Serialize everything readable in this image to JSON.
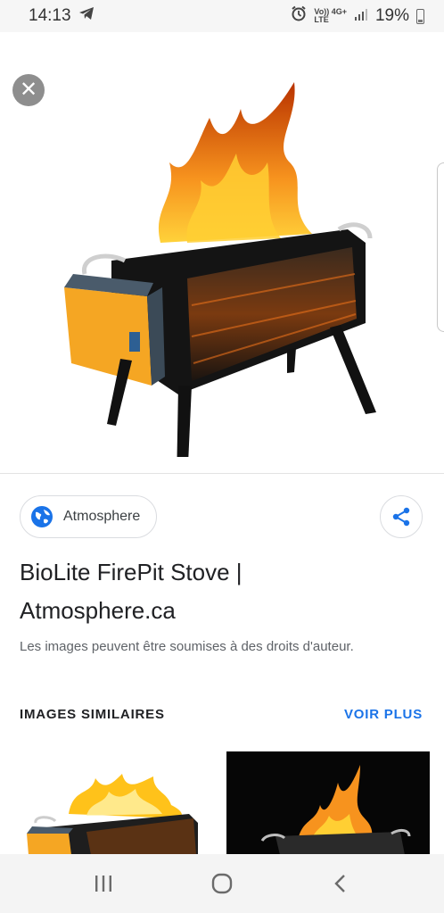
{
  "status_bar": {
    "time": "14:13",
    "network_top": "Vo)) 4G+",
    "network_bottom": "LTE",
    "battery": "19%"
  },
  "result": {
    "source_name": "Atmosphere",
    "title_line1": "BioLite FirePit Stove |",
    "title_line2": "Atmosphere.ca",
    "copyright_notice": "Les images peuvent être soumises à des droits d'auteur."
  },
  "similar": {
    "heading": "IMAGES SIMILAIRES",
    "see_more_label": "VOIR PLUS"
  },
  "colors": {
    "accent_blue": "#1a73e8",
    "flame": "#f7931e",
    "firepit_yellow": "#f5a623"
  }
}
